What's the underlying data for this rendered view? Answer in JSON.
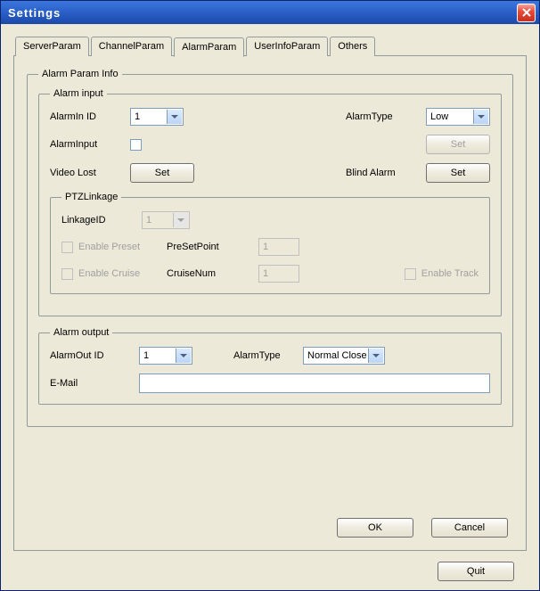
{
  "window": {
    "title": "Settings"
  },
  "tabs": {
    "items": [
      "ServerParam",
      "ChannelParam",
      "AlarmParam",
      "UserInfoParam",
      "Others"
    ],
    "active": 2
  },
  "alarmParamInfo": {
    "legend": "Alarm Param Info",
    "alarmInput": {
      "legend": "Alarm input",
      "alarmInIdLabel": "AlarmIn ID",
      "alarmInIdValue": "1",
      "alarmTypeLabel": "AlarmType",
      "alarmTypeValue": "Low",
      "alarmInputLabel": "AlarmInput",
      "setLabelDisabled": "Set",
      "videoLostLabel": "Video Lost",
      "videoLostSet": "Set",
      "blindAlarmLabel": "Blind Alarm",
      "blindAlarmSet": "Set",
      "ptz": {
        "legend": "PTZLinkage",
        "linkageIdLabel": "LinkageID",
        "linkageIdValue": "1",
        "enablePreset": "Enable Preset",
        "preSetPointLabel": "PreSetPoint",
        "preSetPointValue": "1",
        "enableCruise": "Enable Cruise",
        "cruiseNumLabel": "CruiseNum",
        "cruiseNumValue": "1",
        "enableTrack": "Enable Track"
      }
    },
    "alarmOutput": {
      "legend": "Alarm output",
      "alarmOutIdLabel": "AlarmOut ID",
      "alarmOutIdValue": "1",
      "alarmTypeLabel": "AlarmType",
      "alarmTypeValue": "Normal Close",
      "emailLabel": "E-Mail",
      "emailValue": ""
    },
    "okLabel": "OK",
    "cancelLabel": "Cancel"
  },
  "quitLabel": "Quit"
}
